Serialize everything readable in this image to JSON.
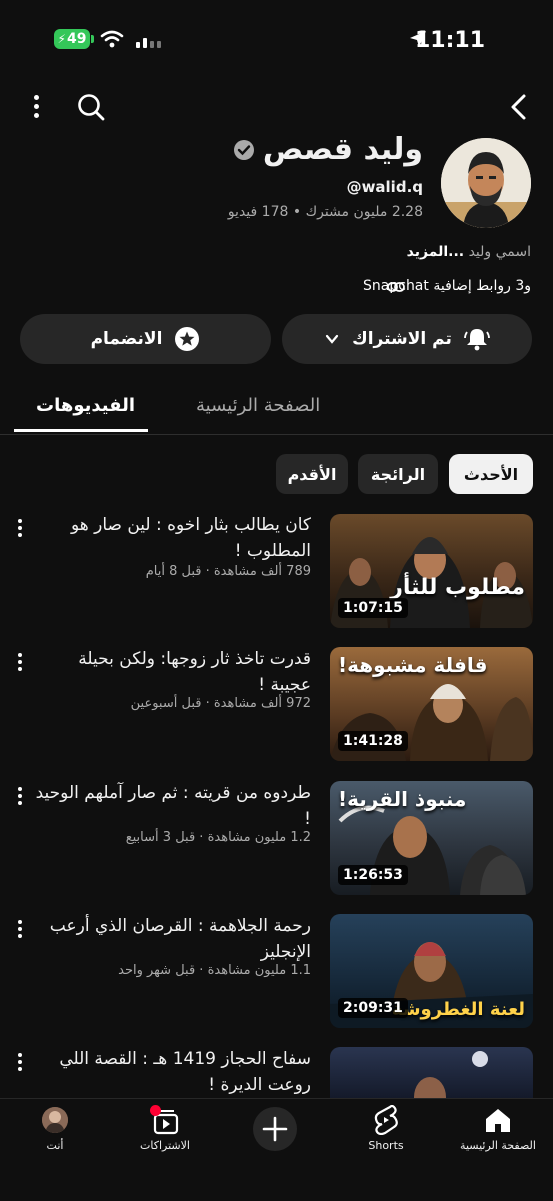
{
  "status_bar": {
    "time": "11:11",
    "battery": "49"
  },
  "channel": {
    "name": "وليد قصص",
    "handle": "@walid.q",
    "stats": "2.28 مليون مشترك • 178 فيديو",
    "description_prefix": "اسمي وليد",
    "more_label": "...المزيد",
    "links_text": "Snapchat و3 روابط إضافية"
  },
  "actions": {
    "subscribed_label": "تم الاشتراك",
    "join_label": "الانضمام"
  },
  "tabs": [
    {
      "label": "الفيديوهات"
    },
    {
      "label": "الصفحة الرئيسية"
    }
  ],
  "chips": [
    {
      "label": "الأحدث"
    },
    {
      "label": "الرائجة"
    },
    {
      "label": "الأقدم"
    }
  ],
  "videos": [
    {
      "title": "كان يطالب بثار اخوه : لين صار هو المطلوب !",
      "meta": "789 ألف مشاهدة · قبل 8 أيام",
      "duration": "1:07:15",
      "thumb_text": "مطلوب للثأر"
    },
    {
      "title": "قدرت تاخذ ثار زوجها: ولكن بحيلة عجيبة !",
      "meta": "972 ألف مشاهدة · قبل أسبوعين",
      "duration": "1:41:28",
      "thumb_text": "قافلة مشبوهة!"
    },
    {
      "title": "طردوه من قريته : ثم صار آملهم الوحيد !",
      "meta": "1.2 مليون مشاهدة · قبل 3 أسابيع",
      "duration": "1:26:53",
      "thumb_text": "منبوذ القرية!"
    },
    {
      "title": "رحمة الجلاهمة : القرصان الذي أرعب الإنجليز",
      "meta": "1.1 مليون مشاهدة · قبل شهر واحد",
      "duration": "2:09:31",
      "thumb_text": "لعنة الغطروشة"
    },
    {
      "title": "سفاح الحجاز 1419 هـ : القصة اللي روعت الديرة !",
      "meta": "",
      "duration": "",
      "thumb_text": ""
    }
  ],
  "bottom_nav": [
    {
      "label": "الصفحة الرئيسية"
    },
    {
      "label": "Shorts"
    },
    {
      "label": ""
    },
    {
      "label": "الاشتراكات"
    },
    {
      "label": "أنت"
    }
  ],
  "colors": {
    "background": "#0f0f0f",
    "chip_selected": "#f1f1f1",
    "battery": "#34c759",
    "notification_dot": "#ff0033"
  }
}
